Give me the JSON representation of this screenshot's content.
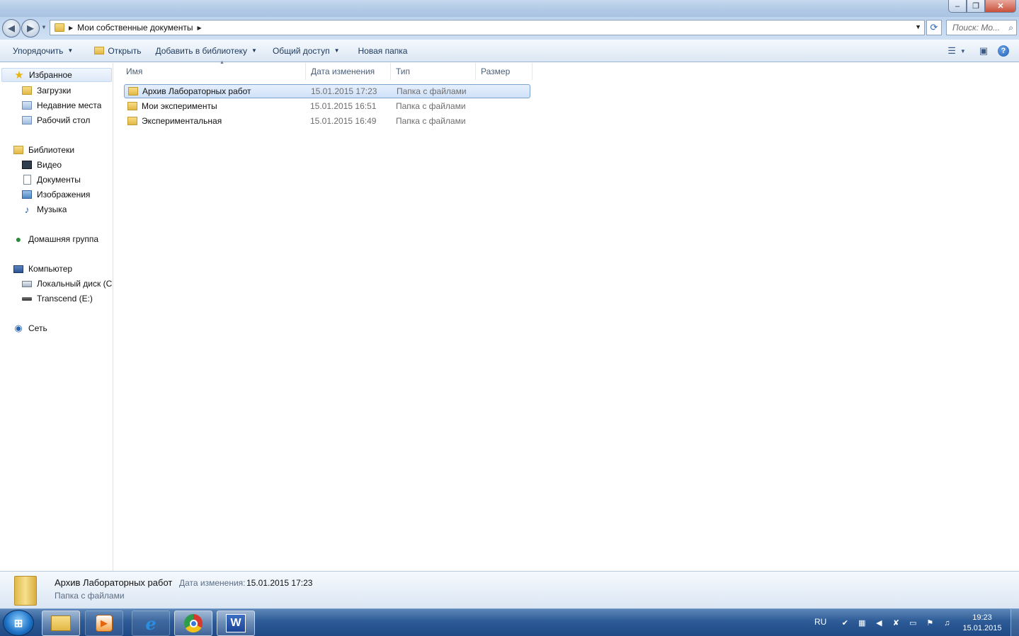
{
  "window": {
    "controls": {
      "minimize": "–",
      "restore": "❐",
      "close": "✕"
    }
  },
  "address": {
    "path": "Мои собственные документы",
    "search_placeholder": "Поиск: Мо..."
  },
  "toolbar": {
    "organize": "Упорядочить",
    "open": "Открыть",
    "add_library": "Добавить в библиотеку",
    "share": "Общий доступ",
    "new_folder": "Новая папка"
  },
  "nav": {
    "favorites": "Избранное",
    "downloads": "Загрузки",
    "recent": "Недавние места",
    "desktop": "Рабочий стол",
    "libraries": "Библиотеки",
    "video": "Видео",
    "documents": "Документы",
    "images": "Изображения",
    "music": "Музыка",
    "homegroup": "Домашняя группа",
    "computer": "Компьютер",
    "local_disk": "Локальный диск (C:)",
    "transcend": "Transcend (E:)",
    "network": "Сеть"
  },
  "columns": {
    "name": "Имя",
    "date": "Дата изменения",
    "type": "Тип",
    "size": "Размер"
  },
  "files": [
    {
      "name": "Архив Лабораторных работ",
      "date": "15.01.2015 17:23",
      "type": "Папка с файлами",
      "selected": true
    },
    {
      "name": "Мои эксперименты",
      "date": "15.01.2015 16:51",
      "type": "Папка с файлами",
      "selected": false
    },
    {
      "name": "Экспериментальная",
      "date": "15.01.2015 16:49",
      "type": "Папка с файлами",
      "selected": false
    }
  ],
  "details": {
    "name": "Архив Лабораторных работ",
    "date_label": "Дата изменения:",
    "date_value": "15.01.2015 17:23",
    "type": "Папка с файлами"
  },
  "taskbar": {
    "lang": "RU",
    "time": "19:23",
    "date": "15.01.2015"
  }
}
